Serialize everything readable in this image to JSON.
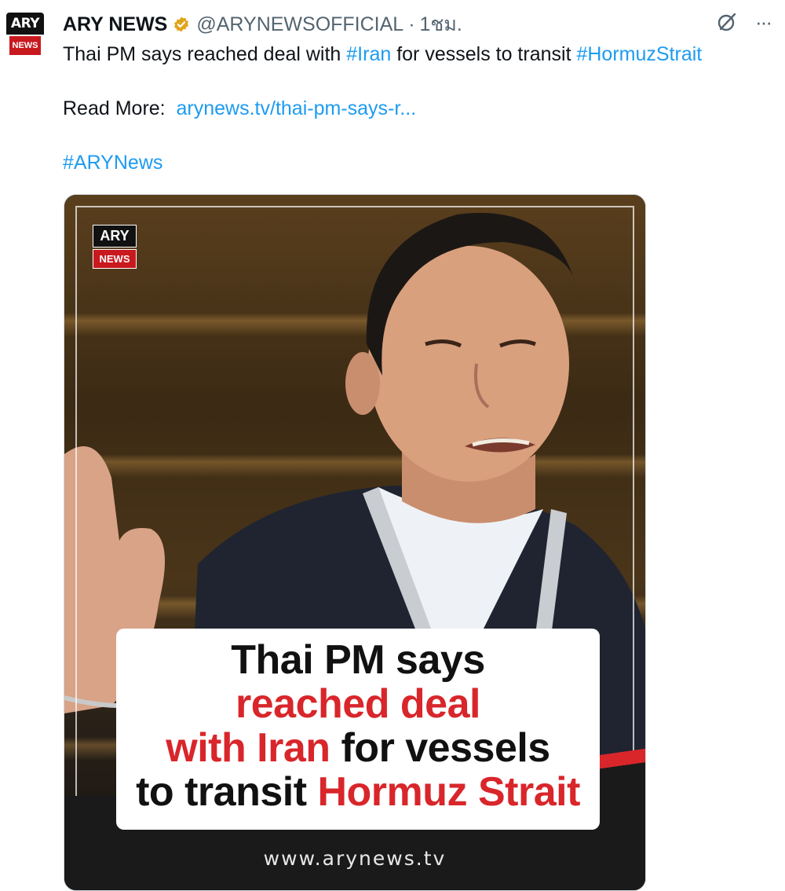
{
  "account": {
    "avatar_logo_top": "ARY",
    "avatar_logo_bottom": "NEWS",
    "name": "ARY NEWS",
    "handle": "@ARYNEWSOFFICIAL",
    "separator": "·",
    "time": "1ชม."
  },
  "icons": {
    "verified": "verified-badge-icon",
    "grok": "grok-icon",
    "more": "more-icon"
  },
  "tweet": {
    "line1_pre": "Thai PM says reached deal with ",
    "line1_tag1": "#Iran",
    "line1_mid": " for vessels to transit ",
    "line1_tag2": "#HormuzStrait",
    "read_more_label": "Read More:  ",
    "read_more_link": "arynews.tv/thai-pm-says-r...",
    "hashtag": "#ARYNews"
  },
  "media": {
    "logo_top": "ARY",
    "logo_bottom": "NEWS",
    "caption": {
      "l1": "Thai PM says",
      "l2": "reached deal",
      "l3_red": "with Iran",
      "l3_black": " for vessels",
      "l4_black": "to transit ",
      "l4_red": "Hormuz Strait"
    },
    "site": "www.arynews.tv"
  },
  "colors": {
    "link": "#1d9bf0",
    "verified_gold": "#e2a41b",
    "brand_red": "#d8262b",
    "muted": "#536471"
  }
}
